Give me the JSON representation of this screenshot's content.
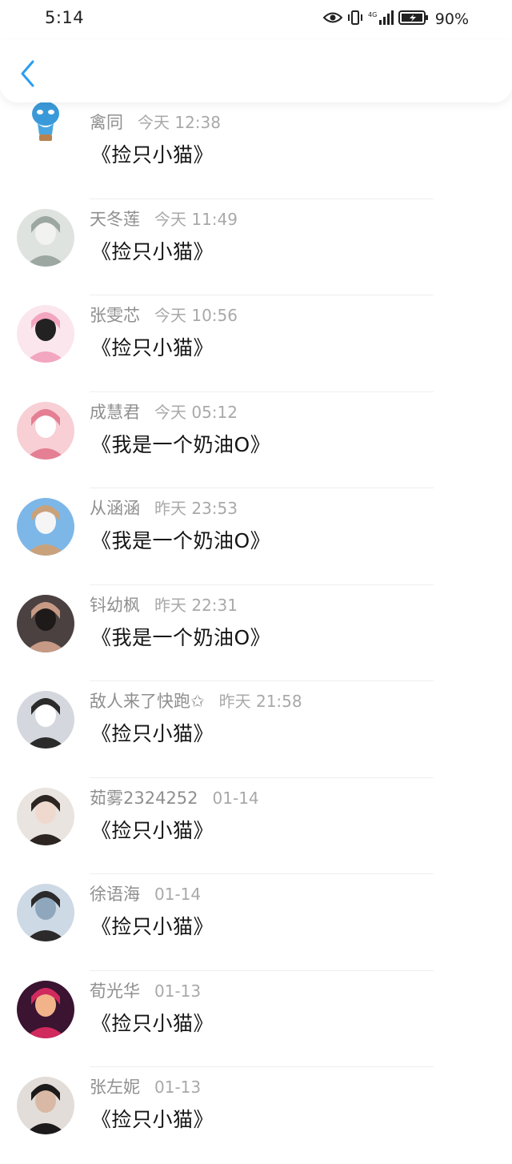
{
  "status_bar": {
    "time": "5:14",
    "network": "4G",
    "battery": "90%"
  },
  "header": {
    "back_icon": "chevron-left-icon",
    "accent": "#2a9df4"
  },
  "rows": [
    {
      "name": "禽同",
      "time": "今天 12:38",
      "message": "《捡只小猫》"
    },
    {
      "name": "天冬莲",
      "time": "今天 11:49",
      "message": "《捡只小猫》"
    },
    {
      "name": "张雯芯",
      "time": "今天 10:56",
      "message": "《捡只小猫》"
    },
    {
      "name": "成慧君",
      "time": "今天 05:12",
      "message": "《我是一个奶油O》"
    },
    {
      "name": "从涵涵",
      "time": "昨天 23:53",
      "message": "《我是一个奶油O》"
    },
    {
      "name": "钭幼枫",
      "time": "昨天 22:31",
      "message": "《我是一个奶油O》"
    },
    {
      "name": "敌人来了快跑✩",
      "time": "昨天 21:58",
      "message": "《捡只小猫》"
    },
    {
      "name": "茹雾2324252",
      "time": "01-14",
      "message": "《捡只小猫》"
    },
    {
      "name": "徐语海",
      "time": "01-14",
      "message": "《捡只小猫》"
    },
    {
      "name": "荀光华",
      "time": "01-13",
      "message": "《捡只小猫》"
    },
    {
      "name": "张左妮",
      "time": "01-13",
      "message": "《捡只小猫》"
    }
  ]
}
